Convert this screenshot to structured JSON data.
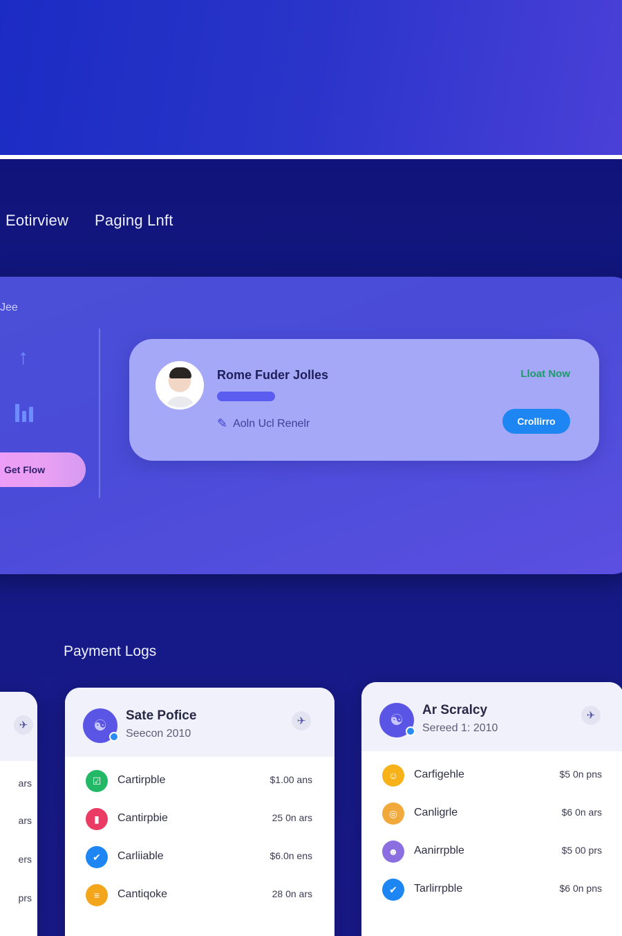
{
  "nav": {
    "tabs": [
      "Eotirview",
      "Paging Lnft"
    ]
  },
  "panel": {
    "label": "Jee",
    "get_button": "Get Flow"
  },
  "profile": {
    "name": "Rome Fuder Jolles",
    "subtitle": "Aoln Ucl Renelr",
    "link": "Lloat Now",
    "button": "Crollirro"
  },
  "logs": {
    "title": "Payment Logs",
    "left_stub": [
      "ars",
      "ars",
      "ers",
      "prs"
    ],
    "cards": [
      {
        "title": "Sate Pofice",
        "subtitle": "Seecon 2010",
        "rows": [
          {
            "icon": "ticket-icon",
            "color": "#22b866",
            "glyph": "☑",
            "label": "Cartirpble",
            "amount": "$1.00 ans"
          },
          {
            "icon": "phone-icon",
            "color": "#ea3b64",
            "glyph": "▮",
            "label": "Cantirpbie",
            "amount": "25 0n ars"
          },
          {
            "icon": "check-icon",
            "color": "#1d86f2",
            "glyph": "✔",
            "label": "Carliiable",
            "amount": "$6.0n ens"
          },
          {
            "icon": "bell-icon",
            "color": "#f3a51c",
            "glyph": "≡",
            "label": "Cantiqoke",
            "amount": "28 0n ars"
          }
        ]
      },
      {
        "title": "Ar Scralcy",
        "subtitle": "Sereed 1: 2010",
        "rows": [
          {
            "icon": "emoji-icon",
            "color": "#f7b21a",
            "glyph": "☺",
            "label": "Carfigehle",
            "amount": "$5 0n pns"
          },
          {
            "icon": "ring-icon",
            "color": "#f0a93a",
            "glyph": "◎",
            "label": "Canligrle",
            "amount": "$6 0n ars"
          },
          {
            "icon": "person-icon",
            "color": "#8b6ee0",
            "glyph": "☻",
            "label": "Aanirrpble",
            "amount": "$5 00 prs"
          },
          {
            "icon": "check-icon",
            "color": "#1d86f2",
            "glyph": "✔",
            "label": "Tarlirrpble",
            "amount": "$6 0n pns"
          }
        ]
      }
    ]
  }
}
